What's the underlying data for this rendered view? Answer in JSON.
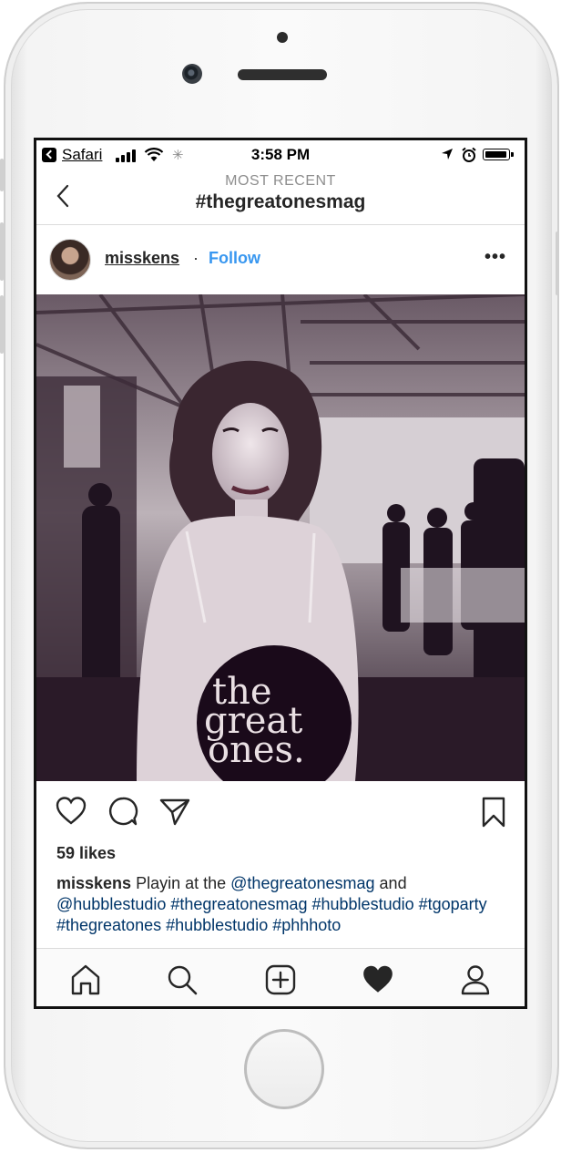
{
  "status_bar": {
    "back_app": "Safari",
    "time": "3:58 PM"
  },
  "nav": {
    "subtitle": "MOST RECENT",
    "title": "#thegreatonesmag"
  },
  "post": {
    "username": "misskens",
    "separator": "·",
    "follow_label": "Follow",
    "more_label": "•••",
    "image_logo": [
      "the",
      "great",
      "ones."
    ],
    "likes": "59 likes",
    "caption": {
      "author": "misskens",
      "text": "Playin at the",
      "mention1": "@thegreatonesmag",
      "and": "and",
      "mention2": "@hubblestudio",
      "tags": [
        "#thegreatonesmag",
        "#hubblestudio",
        "#tgoparty",
        "#thegreatones",
        "#hubblestudio",
        "#phhhoto"
      ]
    }
  },
  "tabs": [
    "home",
    "search",
    "new-post",
    "activity",
    "profile"
  ],
  "colors": {
    "follow_blue": "#3897f0",
    "link_navy": "#003569",
    "text": "#262626"
  }
}
